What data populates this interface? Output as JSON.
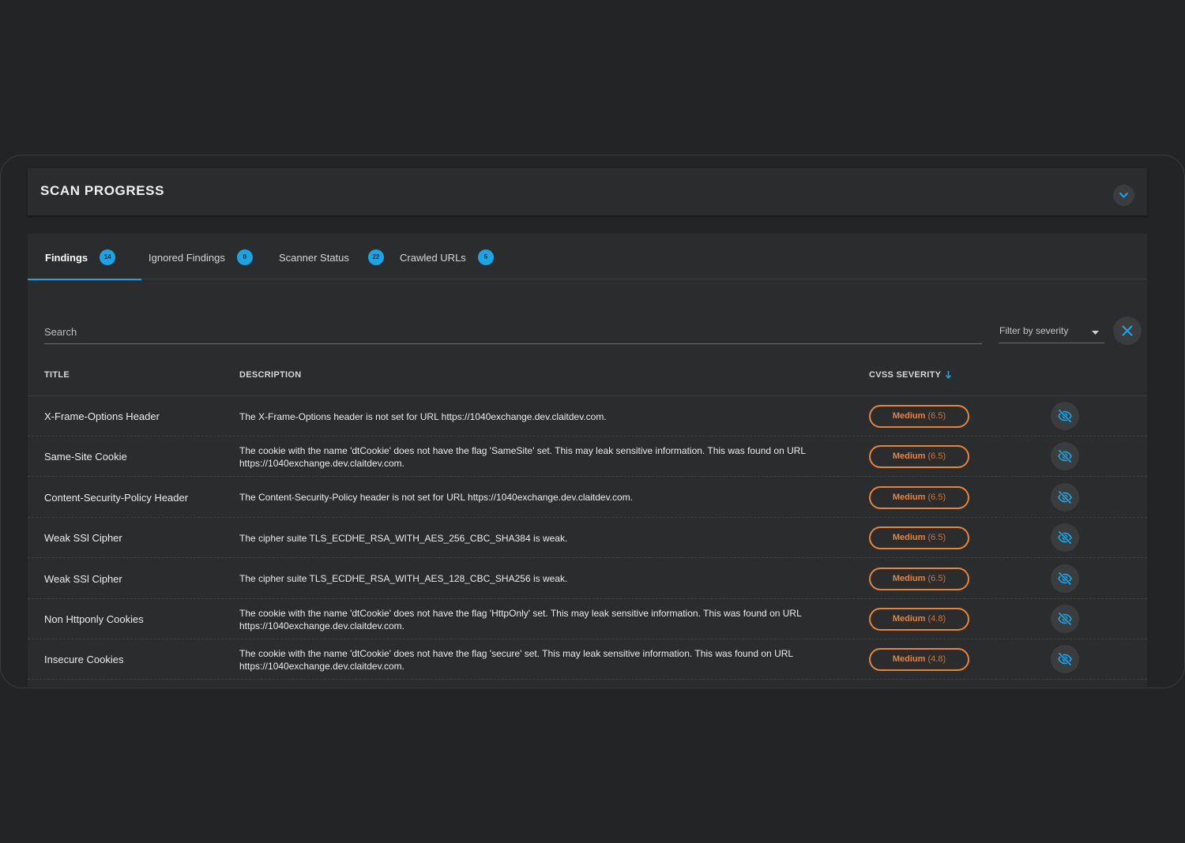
{
  "scan_progress": {
    "title": "SCAN PROGRESS"
  },
  "tabs": [
    {
      "label": "Findings",
      "count": "14",
      "active": true
    },
    {
      "label": "Ignored Findings",
      "count": "0",
      "active": false
    },
    {
      "label": "Scanner Status",
      "count": "22",
      "active": false
    },
    {
      "label": "Crawled URLs",
      "count": "5",
      "active": false
    }
  ],
  "search": {
    "placeholder": "Search"
  },
  "filter": {
    "label": "Filter by severity"
  },
  "table": {
    "headers": {
      "title": "TITLE",
      "description": "DESCRIPTION",
      "severity": "CVSS SEVERITY"
    },
    "rows": [
      {
        "title": "X-Frame-Options Header",
        "description": "The X-Frame-Options header is not set for URL https://1040exchange.dev.claitdev.com.",
        "severity": "Medium",
        "score": "(6.5)"
      },
      {
        "title": "Same-Site Cookie",
        "description": "The cookie with the name 'dtCookie' does not have the flag 'SameSite' set. This may leak sensitive information. This was found on URL https://1040exchange.dev.claitdev.com.",
        "severity": "Medium",
        "score": "(6.5)"
      },
      {
        "title": "Content-Security-Policy Header",
        "description": "The Content-Security-Policy header is not set for URL https://1040exchange.dev.claitdev.com.",
        "severity": "Medium",
        "score": "(6.5)"
      },
      {
        "title": "Weak SSl Cipher",
        "description": "The cipher suite TLS_ECDHE_RSA_WITH_AES_256_CBC_SHA384 is weak.",
        "severity": "Medium",
        "score": "(6.5)"
      },
      {
        "title": "Weak SSl Cipher",
        "description": "The cipher suite TLS_ECDHE_RSA_WITH_AES_128_CBC_SHA256 is weak.",
        "severity": "Medium",
        "score": "(6.5)"
      },
      {
        "title": "Non Httponly Cookies",
        "description": "The cookie with the name 'dtCookie' does not have the flag 'HttpOnly' set. This may leak sensitive information. This was found on URL https://1040exchange.dev.claitdev.com.",
        "severity": "Medium",
        "score": "(4.8)"
      },
      {
        "title": "Insecure Cookies",
        "description": "The cookie with the name 'dtCookie' does not have the flag 'secure' set. This may leak sensitive information. This was found on URL https://1040exchange.dev.claitdev.com.",
        "severity": "Medium",
        "score": "(4.8)"
      }
    ]
  },
  "icons": {
    "collapse": "chevron-down-icon",
    "clear": "close-icon",
    "sort": "arrow-down-icon",
    "ignore": "eye-off-icon",
    "dropdown": "caret-down-icon"
  },
  "colors": {
    "accent": "#1ca3e3",
    "severity_medium": "#e8843a",
    "background": "#232425",
    "panel": "#2b2c2d"
  }
}
